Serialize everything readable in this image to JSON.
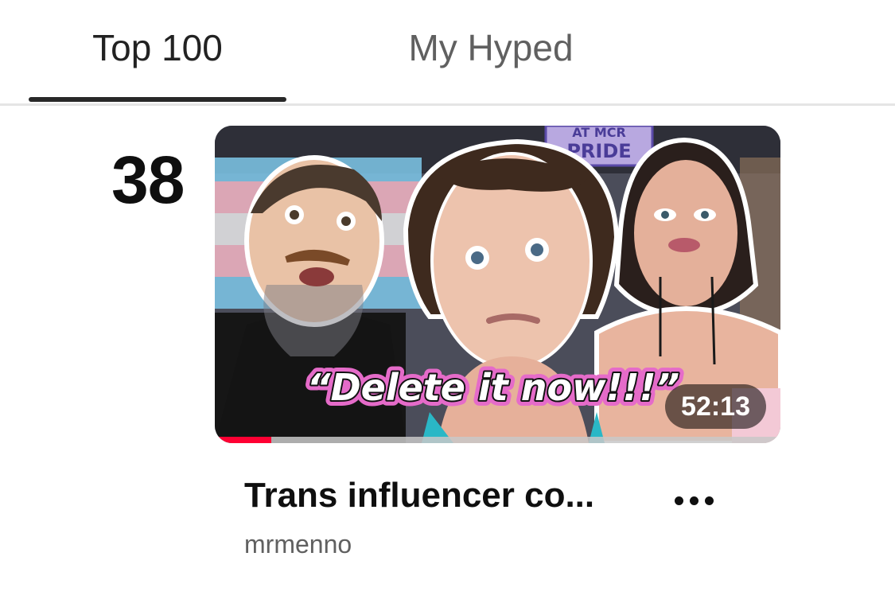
{
  "tabs": [
    {
      "label": "Top 100",
      "selected": true
    },
    {
      "label": "My Hyped",
      "selected": false
    }
  ],
  "video": {
    "rank": "38",
    "thumbnail": {
      "sign_line1": "AT MCR",
      "sign_line2": "PRIDE",
      "caption": "“Delete it now!!!”"
    },
    "duration": "52:13",
    "watch_progress": 0.1,
    "title": "Trans influencer co...",
    "channel": "mrmenno",
    "more_icon": "more-horizontal-icon"
  },
  "colors": {
    "progress": "#ff0033",
    "caption_outline": "#e56bc9",
    "tab_indicator": "#282828"
  }
}
